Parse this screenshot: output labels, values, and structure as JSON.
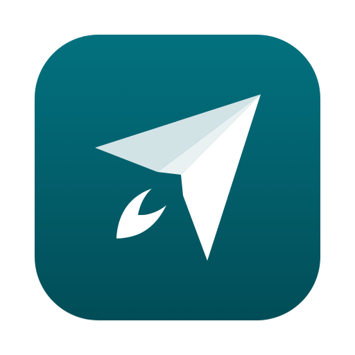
{
  "app_icon": {
    "icon": "paper-plane-icon",
    "colors": {
      "background_top": "#03717F",
      "background_bottom": "#014D57",
      "plane_light": "#FFFFFF",
      "plane_shade": "#D2E3E6",
      "plane_mid": "#E9F1F2"
    }
  }
}
